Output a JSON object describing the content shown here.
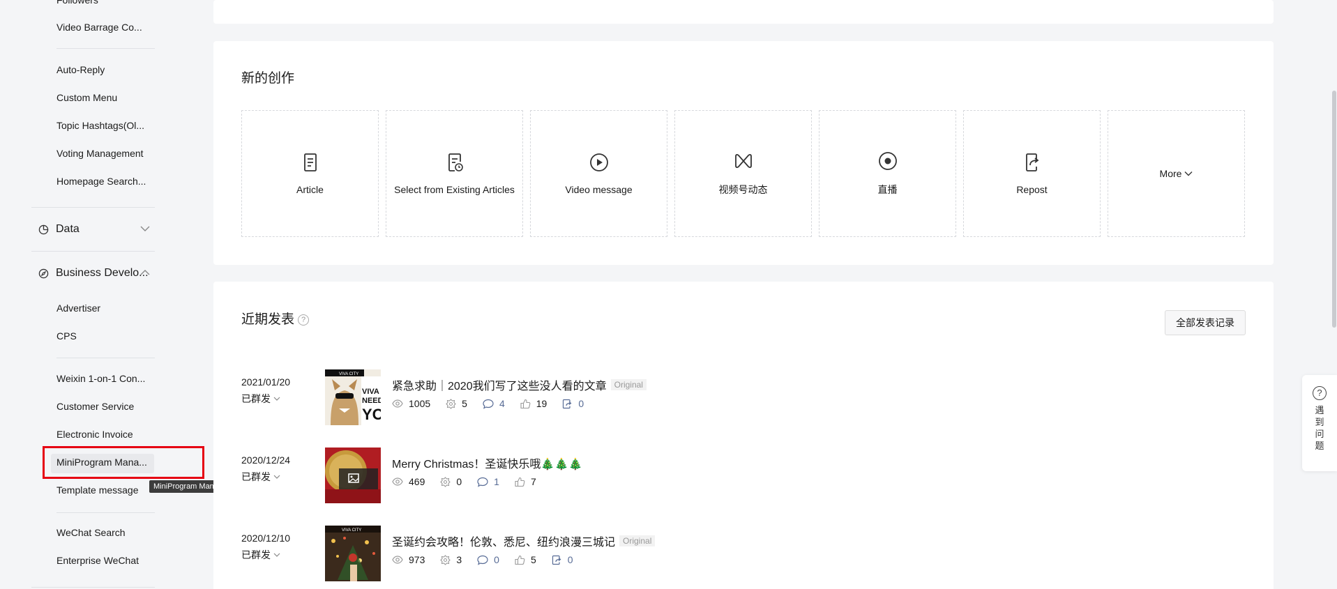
{
  "sidebar": {
    "items_top": [
      "Followers",
      "Video Barrage Co..."
    ],
    "items_group2": [
      "Auto-Reply",
      "Custom Menu",
      "Topic Hashtags(Ol...",
      "Voting Management",
      "Homepage Search..."
    ],
    "data_section": "Data",
    "business_section": "Business Develo...",
    "items_business": [
      "Advertiser",
      "CPS"
    ],
    "items_group4": [
      "Weixin 1-on-1 Con...",
      "Customer Service",
      "Electronic Invoice",
      "MiniProgram Mana...",
      "Template message"
    ],
    "items_group5": [
      "WeChat Search",
      "Enterprise WeChat"
    ],
    "tooltip": "MiniProgram Manage"
  },
  "new_creation": {
    "title": "新的创作",
    "tiles": [
      {
        "label": "Article",
        "icon": "article-icon"
      },
      {
        "label": "Select from Existing Articles",
        "icon": "existing-article-icon"
      },
      {
        "label": "Video message",
        "icon": "play-icon"
      },
      {
        "label": "视频号动态",
        "icon": "channels-icon"
      },
      {
        "label": "直播",
        "icon": "live-icon"
      },
      {
        "label": "Repost",
        "icon": "repost-icon"
      }
    ],
    "more_label": "More"
  },
  "recent": {
    "title": "近期发表",
    "help": "?",
    "all_button": "全部发表记录",
    "posts": [
      {
        "date": "2021/01/20",
        "status": "已群发",
        "title": "紧急求助｜2020我们写了这些没人看的文章",
        "badge": "Original",
        "views": "1005",
        "shares": "5",
        "comments": "4",
        "likes": "19",
        "reposts": "0"
      },
      {
        "date": "2020/12/24",
        "status": "已群发",
        "title": "Merry Christmas！圣诞快乐哦🎄🎄🎄",
        "badge": "",
        "views": "469",
        "shares": "0",
        "comments": "1",
        "likes": "7",
        "reposts": ""
      },
      {
        "date": "2020/12/10",
        "status": "已群发",
        "title": "圣诞约会攻略！伦敦、悉尼、纽约浪漫三城记",
        "badge": "Original",
        "views": "973",
        "shares": "3",
        "comments": "0",
        "likes": "5",
        "reposts": "0"
      }
    ],
    "thumb_text": {
      "brand": "VIVA CITY",
      "line1": "VIVA",
      "line2": "NEED",
      "line3": "YO"
    }
  },
  "float_help": {
    "q": "?",
    "text": "遇到问题"
  },
  "colors": {
    "accent": "#576b95",
    "highlight": "#e60012"
  }
}
